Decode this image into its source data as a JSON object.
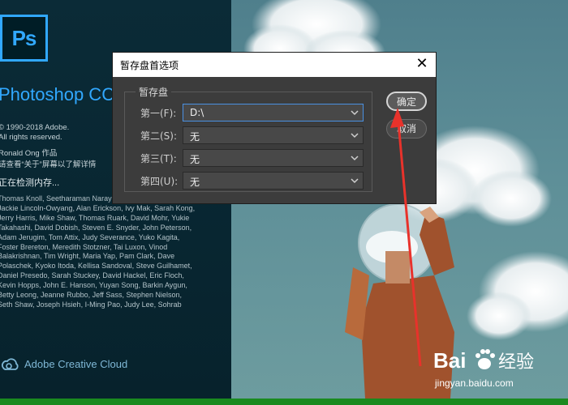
{
  "splash": {
    "logo_text": "Ps",
    "app_name": "Photoshop CC",
    "copyright_lines": [
      "© 1990-2018 Adobe.",
      "All rights reserved."
    ],
    "author": "Ronald Ong 作品",
    "about_hint": "请查看“关于”屏幕以了解详情",
    "status": "正在检测内存...",
    "credits": [
      "Thomas Knoll, Seetharaman Narayanan,",
      "Jackie Lincoln-Owyang, Alan Erickson, Ivy Mak, Sarah Kong,",
      "Jerry Harris, Mike Shaw, Thomas Ruark, David Mohr, Yukie",
      "Takahashi, David Dobish, Steven E. Snyder, John Peterson,",
      "Adam Jerugim, Tom Attix, Judy Severance, Yuko Kagita,",
      "Foster Brereton, Meredith Stotzner, Tai Luxon, Vinod",
      "Balakrishnan, Tim Wright, Maria Yap, Pam Clark, Dave",
      "Polaschek, Kyoko Itoda, Kellisa Sandoval, Steve Guilhamet,",
      "Daniel Presedo, Sarah Stuckey, David Hackel, Eric Floch,",
      "Kevin Hopps, John E. Hanson, Yuyan Song, Barkin Aygun,",
      "Betty Leong, Jeanne Rubbo, Jeff Sass, Stephen Nielson,",
      "Seth Shaw, Joseph Hsieh, I-Ming Pao, Judy Lee, Sohrab"
    ],
    "cloud_label": "Adobe Creative Cloud"
  },
  "dialog": {
    "title": "暂存盘首选项",
    "close_glyph": "✕",
    "group_label": "暂存盘",
    "rows": [
      {
        "label": "第一(F):",
        "value": "D:\\"
      },
      {
        "label": "第二(S):",
        "value": "无"
      },
      {
        "label": "第三(T):",
        "value": "无"
      },
      {
        "label": "第四(U):",
        "value": "无"
      }
    ],
    "ok_label": "确定",
    "cancel_label": "取消"
  },
  "watermark": {
    "brand": "Bai经验",
    "url": "jingyan.baidu.com"
  },
  "colors": {
    "accent": "#31a8ff",
    "dialog_bg": "#3c3c3c",
    "focus_border": "#4a90e2",
    "annotation_red": "#e8322b",
    "bottom_bar": "#1a8a1f"
  },
  "icons": [
    "creative-cloud-icon",
    "chevron-down-icon",
    "close-icon",
    "paw-icon"
  ]
}
